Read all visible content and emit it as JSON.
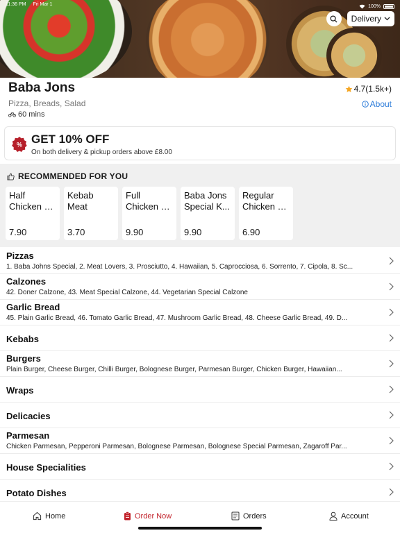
{
  "status": {
    "time": "11:36 PM",
    "date": "Fri Mar 1",
    "battery": "100%"
  },
  "header": {
    "delivery_mode": "Delivery"
  },
  "restaurant": {
    "name": "Baba Jons",
    "rating": "4.7(1.5k+)",
    "cuisine": "Pizza, Breads, Salad",
    "about_label": "About",
    "delivery_time": "60 mins"
  },
  "offer": {
    "title": "GET 10% OFF",
    "subtitle": "On both delivery & pickup orders above £8.00"
  },
  "recommended": {
    "heading": "RECOMMENDED FOR YOU",
    "items": [
      {
        "line1": "Half",
        "line2": "Chicken P...",
        "price": "7.90"
      },
      {
        "line1": "Kebab",
        "line2": "Meat",
        "price": "3.70"
      },
      {
        "line1": "Full",
        "line2": "Chicken P...",
        "price": "9.90"
      },
      {
        "line1": "Baba Jons",
        "line2": "Special K...",
        "price": "9.90"
      },
      {
        "line1": "Regular",
        "line2": "Chicken K...",
        "price": "6.90"
      }
    ]
  },
  "menu": [
    {
      "title": "Pizzas",
      "desc": "1. Baba Johns Special, 2. Meat Lovers, 3. Prosciutto, 4. Hawaiian, 5. Caprocciosa, 6. Sorrento, 7. Cipola, 8. Sc..."
    },
    {
      "title": "Calzones",
      "desc": "42. Doner Calzone, 43. Meat Special Calzone, 44. Vegetarian Special Calzone"
    },
    {
      "title": "Garlic Bread",
      "desc": "45. Plain Garlic Bread, 46. Tomato Garlic Bread, 47. Mushroom Garlic Bread, 48. Cheese Garlic Bread, 49. D..."
    },
    {
      "title": "Kebabs",
      "desc": ""
    },
    {
      "title": "Burgers",
      "desc": "Plain Burger, Cheese Burger, Chilli Burger, Bolognese Burger, Parmesan Burger, Chicken Burger, Hawaiian..."
    },
    {
      "title": "Wraps",
      "desc": ""
    },
    {
      "title": "Delicacies",
      "desc": ""
    },
    {
      "title": "Parmesan",
      "desc": "Chicken Parmesan, Pepperoni Parmesan, Bolognese Parmesan, Bolognese Special Parmesan, Zagaroff Par..."
    },
    {
      "title": "House Specialities",
      "desc": ""
    },
    {
      "title": "Potato Dishes",
      "desc": ""
    }
  ],
  "tabs": [
    {
      "label": "Home",
      "icon": "home-icon"
    },
    {
      "label": "Order Now",
      "icon": "order-icon"
    },
    {
      "label": "Orders",
      "icon": "receipt-icon"
    },
    {
      "label": "Account",
      "icon": "person-icon"
    }
  ],
  "colors": {
    "accent": "#c11f28",
    "link": "#2b7bd9",
    "star": "#f5a623",
    "section_bg": "#f0f0f0"
  }
}
